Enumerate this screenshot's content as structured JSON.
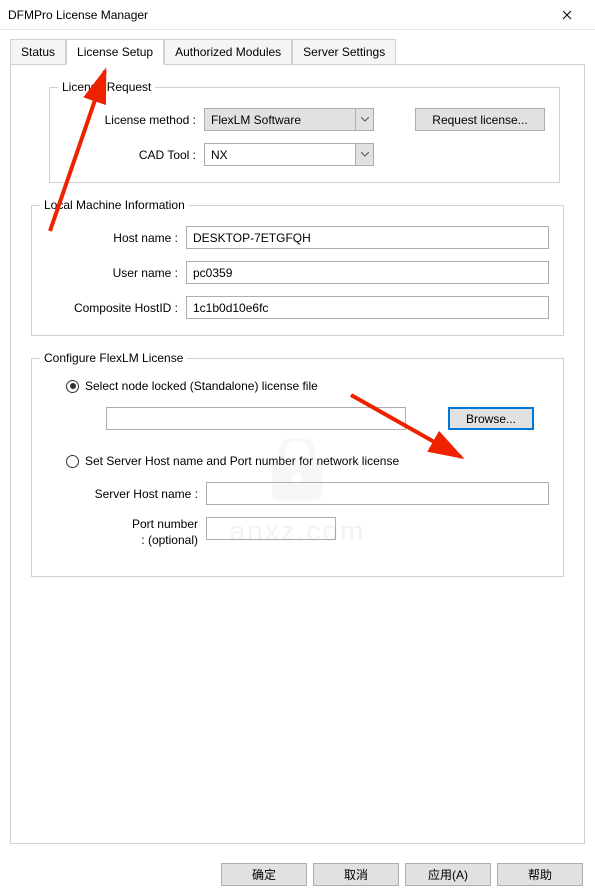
{
  "window": {
    "title": "DFMPro License Manager"
  },
  "tabs": {
    "status": "Status",
    "license_setup": "License Setup",
    "authorized_modules": "Authorized Modules",
    "server_settings": "Server Settings"
  },
  "license_request": {
    "group_title": "License Request",
    "method_label": "License method :",
    "method_value": "FlexLM Software",
    "cad_label": "CAD Tool :",
    "cad_value": "NX",
    "request_btn": "Request license..."
  },
  "local_machine": {
    "group_title": "Local Machine Information",
    "host_label": "Host name :",
    "host_value": "DESKTOP-7ETGFQH",
    "user_label": "User name :",
    "user_value": "pc0359",
    "composite_label": "Composite HostID :",
    "composite_value": "1c1b0d10e6fc"
  },
  "configure": {
    "group_title": "Configure FlexLM License",
    "radio_node": "Select node locked (Standalone) license file",
    "browse_btn": "Browse...",
    "radio_server": "Set Server Host name and Port number for network license",
    "server_host_label": "Server Host name :",
    "port_label1": "Port number",
    "port_label2": ": (optional)"
  },
  "footer": {
    "ok": "确定",
    "cancel": "取消",
    "apply": "应用(A)",
    "help": "帮助"
  }
}
